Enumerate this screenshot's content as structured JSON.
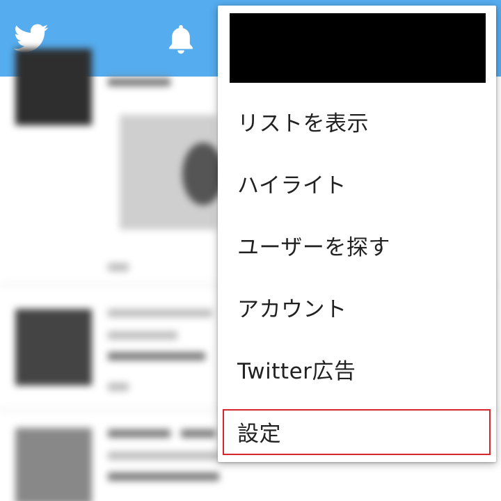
{
  "app": {
    "brand_color": "#55acee",
    "icons": {
      "logo": "twitter-bird-icon",
      "notifications": "bell-icon"
    }
  },
  "menu": {
    "header_redacted": true,
    "items": [
      {
        "label": "リストを表示"
      },
      {
        "label": "ハイライト"
      },
      {
        "label": "ユーザーを探す"
      },
      {
        "label": "アカウント"
      },
      {
        "label": "Twitter広告"
      },
      {
        "label": "設定",
        "highlighted": true
      }
    ],
    "highlight_color": "#d8252b"
  }
}
